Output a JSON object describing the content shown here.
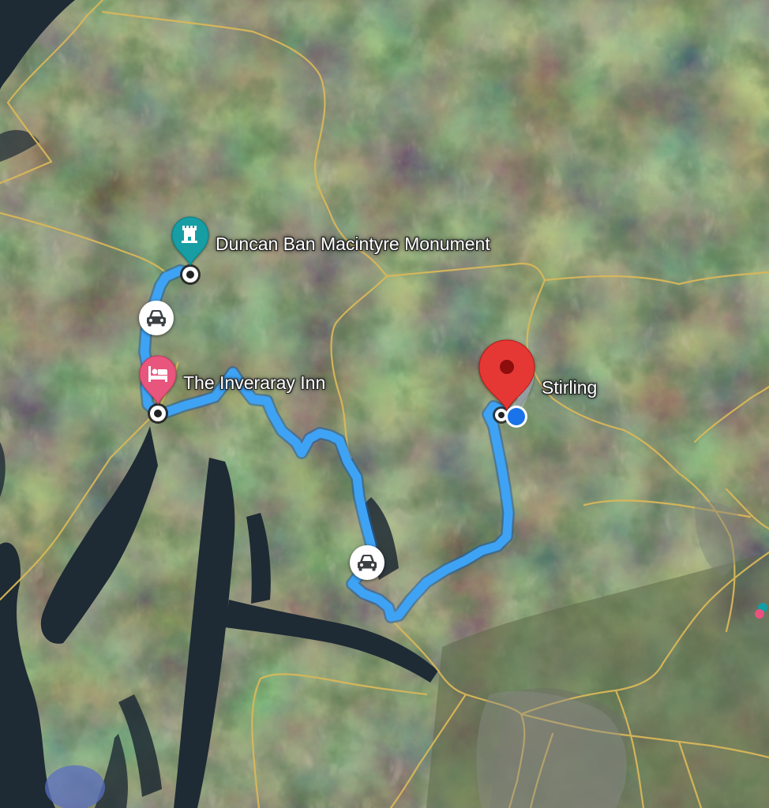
{
  "map": {
    "type": "satellite",
    "route_color": "#3ea3f5",
    "places": [
      {
        "label": "Duncan Ban Macintyre Monument",
        "icon": "monument-castle-icon",
        "pin_color": "#129ea4"
      },
      {
        "label": "The Inveraray Inn",
        "icon": "hotel-bed-icon",
        "pin_color": "#e8547d"
      },
      {
        "label": "Stirling",
        "icon": "red-location-pin-icon",
        "pin_color": "#e53935"
      }
    ],
    "travel_mode_icon": "car-icon",
    "current_location_color": "#1a73e8"
  }
}
